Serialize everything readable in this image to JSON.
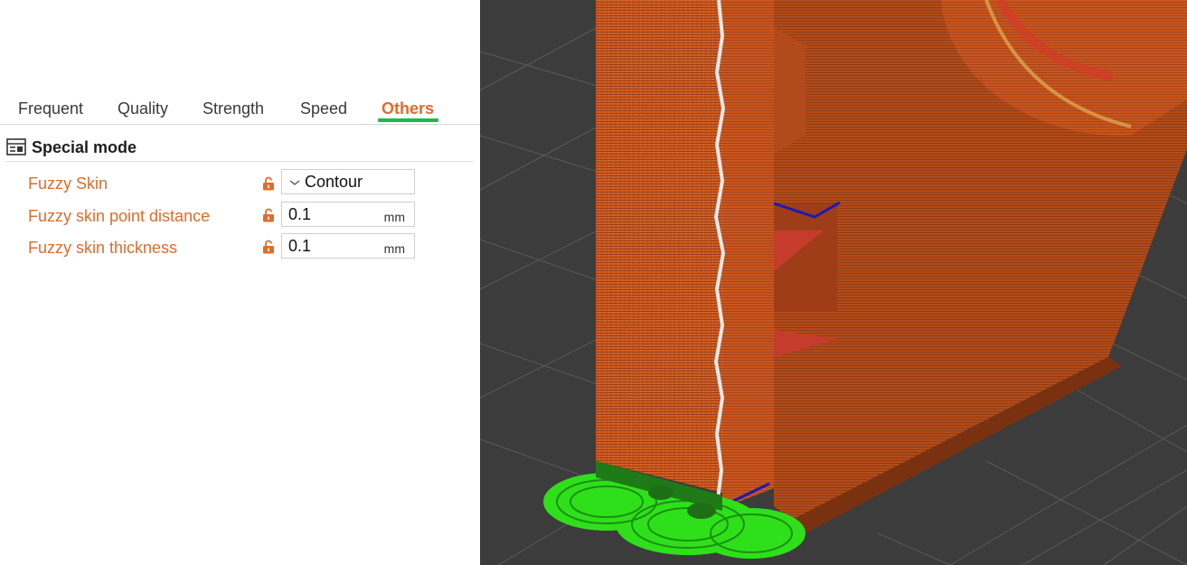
{
  "tabs": [
    {
      "label": "Frequent"
    },
    {
      "label": "Quality"
    },
    {
      "label": "Strength"
    },
    {
      "label": "Speed"
    },
    {
      "label": "Others"
    }
  ],
  "active_tab": "Others",
  "section": {
    "title": "Special mode",
    "icon": "settings-panel-icon"
  },
  "settings": {
    "fuzzy_skin": {
      "label": "Fuzzy Skin",
      "value": "Contour"
    },
    "point_distance": {
      "label": "Fuzzy skin point distance",
      "value": "0.1",
      "unit": "mm"
    },
    "thickness": {
      "label": "Fuzzy skin thickness",
      "value": "0.1",
      "unit": "mm"
    }
  },
  "colors": {
    "accent": "#e06c2c",
    "tab_indicator": "#1fb84a",
    "viewport_bg": "#3c3c3c",
    "model_orange": "#c8561e",
    "support_green": "#2ee01a",
    "travel_blue": "#1a1ab4"
  },
  "icons": {
    "lock": "unlocked-padlock-icon",
    "dropdown": "chevron-down-icon"
  }
}
